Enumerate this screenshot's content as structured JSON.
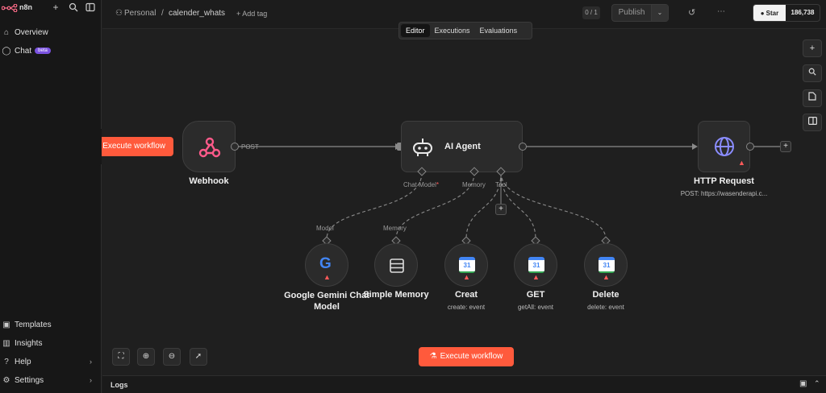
{
  "app": {
    "name": "n8n"
  },
  "sidebar": {
    "items": [
      {
        "label": "Overview"
      },
      {
        "label": "Chat",
        "badge": "beta"
      }
    ],
    "bottom": [
      {
        "label": "Templates"
      },
      {
        "label": "Insights"
      },
      {
        "label": "Help"
      },
      {
        "label": "Settings"
      }
    ]
  },
  "topbar": {
    "project": "Personal",
    "workflow_name": "calender_whats",
    "add_tag": "+ Add tag",
    "version_counter": "0 / 1",
    "publish_label": "Publish",
    "github_star_label": "Star",
    "github_star_count": "186,738"
  },
  "tabs": [
    {
      "label": "Editor",
      "active": true
    },
    {
      "label": "Executions"
    },
    {
      "label": "Evaluations"
    }
  ],
  "nodes": {
    "webhook": {
      "title": "Webhook",
      "output_label": "POST"
    },
    "ai_agent": {
      "title": "AI Agent",
      "handles": {
        "chat_model": "Chat Model",
        "chat_model_required": "*",
        "memory": "Memory",
        "tool": "Tool"
      }
    },
    "http_request": {
      "title": "HTTP Request",
      "subtitle": "POST: https://wasenderapi.c..."
    },
    "gemini": {
      "title": "Google Gemini Chat Model",
      "input_label": "Model"
    },
    "memory": {
      "title": "Simple Memory",
      "input_label": "Memory"
    },
    "creat": {
      "title": "Creat",
      "subtitle": "create: event",
      "calendar_day": "31"
    },
    "get": {
      "title": "GET",
      "subtitle": "getAll: event",
      "calendar_day": "31"
    },
    "delete": {
      "title": "Delete",
      "subtitle": "delete: event",
      "calendar_day": "31"
    }
  },
  "buttons": {
    "execute_workflow_left": "Execute workflow",
    "execute_workflow_bottom": "Execute workflow"
  },
  "logs": {
    "label": "Logs"
  },
  "colors": {
    "accent": "#ff5a3c",
    "beta": "#7a52e0",
    "webhook_icon": "#ff5a8a",
    "globe_icon": "#8a8cff"
  }
}
